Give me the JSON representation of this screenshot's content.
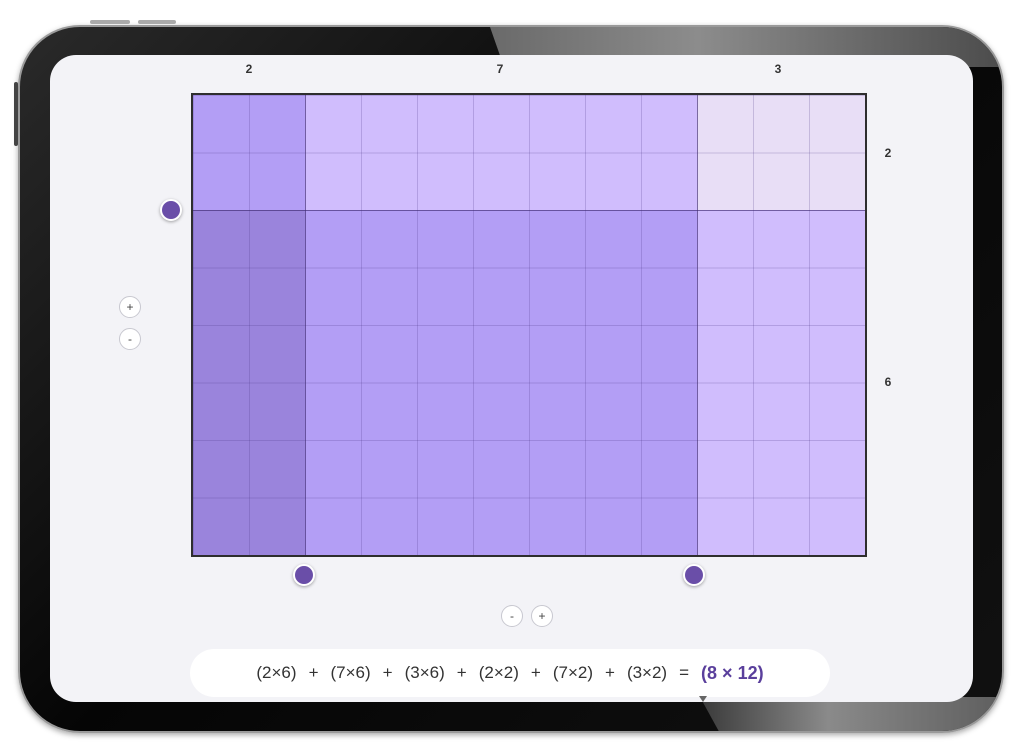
{
  "dimensions": {
    "columns": [
      "2",
      "7",
      "3"
    ],
    "rows": [
      "2",
      "6"
    ]
  },
  "controls": {
    "row_plus": "+",
    "row_minus": "-",
    "col_minus": "-",
    "col_plus": "+"
  },
  "equation": {
    "terms": [
      "(2×6)",
      "(7×6)",
      "(3×6)",
      "(2×2)",
      "(7×2)",
      "(3×2)"
    ],
    "operator": "+",
    "equals": "=",
    "result": "(8 × 12)"
  },
  "colors": {
    "dark_region": "#9a84dc",
    "mid_region": "#b39ef5",
    "light_region": "#d0bdfd",
    "pale_region": "#e8def6",
    "handle": "#6a4ea8",
    "result_text": "#5a3f9c"
  }
}
